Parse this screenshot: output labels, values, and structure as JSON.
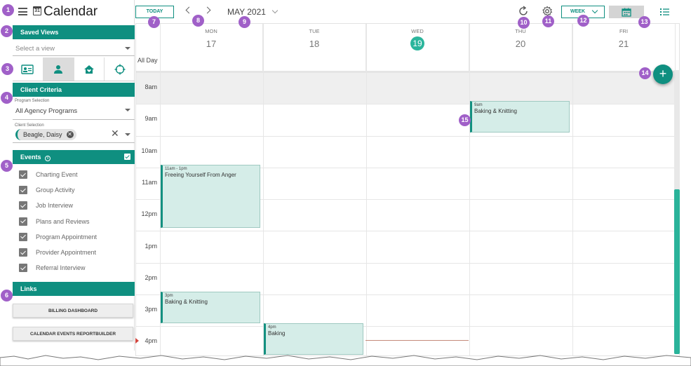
{
  "app": {
    "title": "Calendar",
    "calendar_icon_day": "31"
  },
  "saved_views": {
    "heading": "Saved Views",
    "placeholder": "Select a view"
  },
  "view_tabs": [
    {
      "icon": "id-card-icon"
    },
    {
      "icon": "person-icon",
      "active": true
    },
    {
      "icon": "house-heart-icon"
    },
    {
      "icon": "crosshair-icon"
    }
  ],
  "client_criteria": {
    "heading": "Client Criteria",
    "program_label": "Program Selection",
    "program_value": "All Agency Programs",
    "client_label": "Client Selection",
    "client_chip": "Beagle, Daisy",
    "chip_remove": "✕",
    "clear": "✕"
  },
  "events": {
    "heading": "Events",
    "info": "i",
    "items": [
      "Charting Event",
      "Group Activity",
      "Job Interview",
      "Plans and Reviews",
      "Program Appointment",
      "Provider Appointment",
      "Referral Interview"
    ]
  },
  "links": {
    "heading": "Links",
    "buttons": [
      "BILLING DASHBOARD",
      "CALENDAR EVENTS REPORTBUILDER"
    ]
  },
  "toolbar": {
    "today_label": "TODAY",
    "month_label": "MAY 2021",
    "week_label": "WEEK",
    "icons": [
      "refresh-icon",
      "gear-icon",
      "calendar-view-icon",
      "list-view-icon"
    ]
  },
  "calendar": {
    "all_day_label": "All Day",
    "days": [
      {
        "name": "MON",
        "num": "17"
      },
      {
        "name": "TUE",
        "num": "18"
      },
      {
        "name": "WED",
        "num": "19",
        "today": true
      },
      {
        "name": "THU",
        "num": "20"
      },
      {
        "name": "FRI",
        "num": "21"
      }
    ],
    "hours": [
      "8am",
      "9am",
      "10am",
      "11am",
      "12pm",
      "1pm",
      "2pm",
      "3pm",
      "4pm"
    ],
    "events": [
      {
        "time": "9am",
        "title": "Baking & Knitting"
      },
      {
        "time": "11am - 1pm",
        "title": "Freeing Yourself From Anger"
      },
      {
        "time": "3pm",
        "title": "Baking & Knitting"
      },
      {
        "time": "4pm",
        "title": "Baking"
      }
    ],
    "add_label": "+"
  },
  "badges": [
    "1",
    "2",
    "3",
    "4",
    "5",
    "6",
    "7",
    "8",
    "9",
    "10",
    "11",
    "12",
    "13",
    "14",
    "15"
  ],
  "colors": {
    "accent": "#0f8f80",
    "today": "#2bb59c",
    "event_bg": "#d5ede8",
    "badge": "#a060c8"
  }
}
